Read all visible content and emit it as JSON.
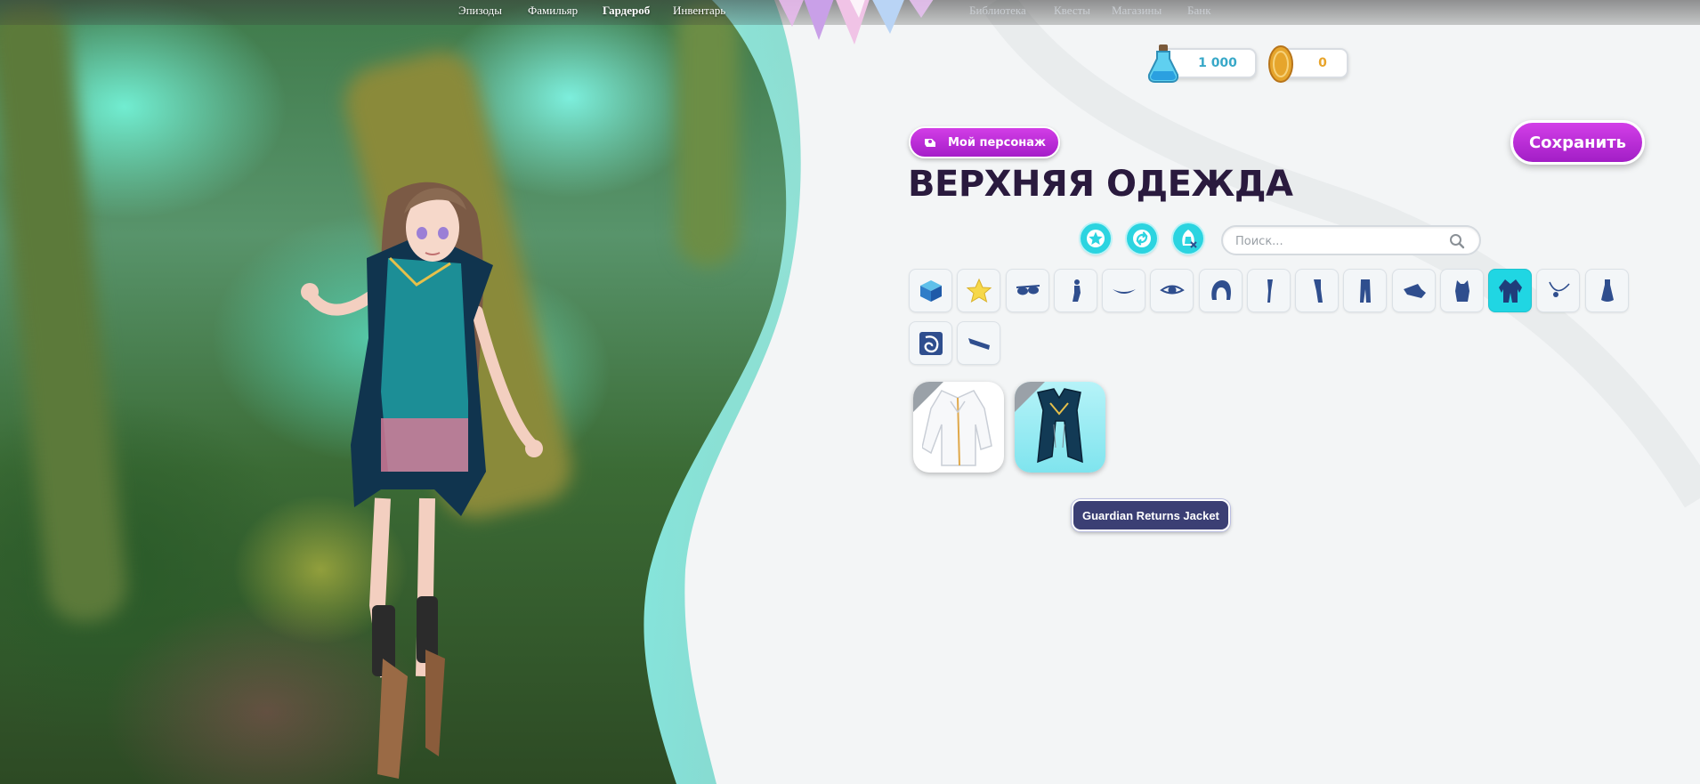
{
  "nav": {
    "left": [
      {
        "label": "Эпизоды",
        "active": false
      },
      {
        "label": "Фамильяр",
        "active": false
      },
      {
        "label": "Гардероб",
        "active": true
      },
      {
        "label": "Инвентарь",
        "active": false
      }
    ],
    "right": [
      {
        "label": "Библиотека"
      },
      {
        "label": "Квесты"
      },
      {
        "label": "Магазины"
      },
      {
        "label": "Банк"
      }
    ]
  },
  "currency": {
    "mana": "1 000",
    "gold": "0"
  },
  "header": {
    "my_character_label": "Мой персонаж",
    "save_label": "Сохранить",
    "title": "ВЕРХНЯЯ ОДЕЖДА"
  },
  "filters": [
    {
      "icon": "star-icon"
    },
    {
      "icon": "swap-icon"
    },
    {
      "icon": "hide-outfit-icon"
    }
  ],
  "search": {
    "placeholder": "Поиск...",
    "value": ""
  },
  "categories": [
    {
      "icon": "box-icon",
      "active": false
    },
    {
      "icon": "favorite-star-icon",
      "active": false
    },
    {
      "icon": "glasses-icon",
      "active": false
    },
    {
      "icon": "body-icon",
      "active": false
    },
    {
      "icon": "eyebrows-icon",
      "active": false
    },
    {
      "icon": "eye-icon",
      "active": false
    },
    {
      "icon": "hair-icon",
      "active": false
    },
    {
      "icon": "legs-icon",
      "active": false
    },
    {
      "icon": "tights-icon",
      "active": false
    },
    {
      "icon": "pants-icon",
      "active": false
    },
    {
      "icon": "socks-icon",
      "active": false
    },
    {
      "icon": "top-icon",
      "active": false
    },
    {
      "icon": "jacket-icon",
      "active": true
    },
    {
      "icon": "necklace-icon",
      "active": false
    },
    {
      "icon": "dress-icon",
      "active": false
    },
    {
      "icon": "background-icon",
      "active": false
    },
    {
      "icon": "shoes-icon",
      "active": false
    }
  ],
  "items": [
    {
      "icon": "white-jacket-icon"
    },
    {
      "icon": "guardian-jacket-icon"
    }
  ],
  "tooltip": {
    "text": "Guardian Returns Jacket"
  },
  "colors": {
    "accent_purple": "#b62bd6",
    "accent_cyan": "#20d6e3",
    "title_dark": "#2a1a3e",
    "icon_navy": "#2f4e8e",
    "tooltip_bg": "#3b3f74"
  }
}
